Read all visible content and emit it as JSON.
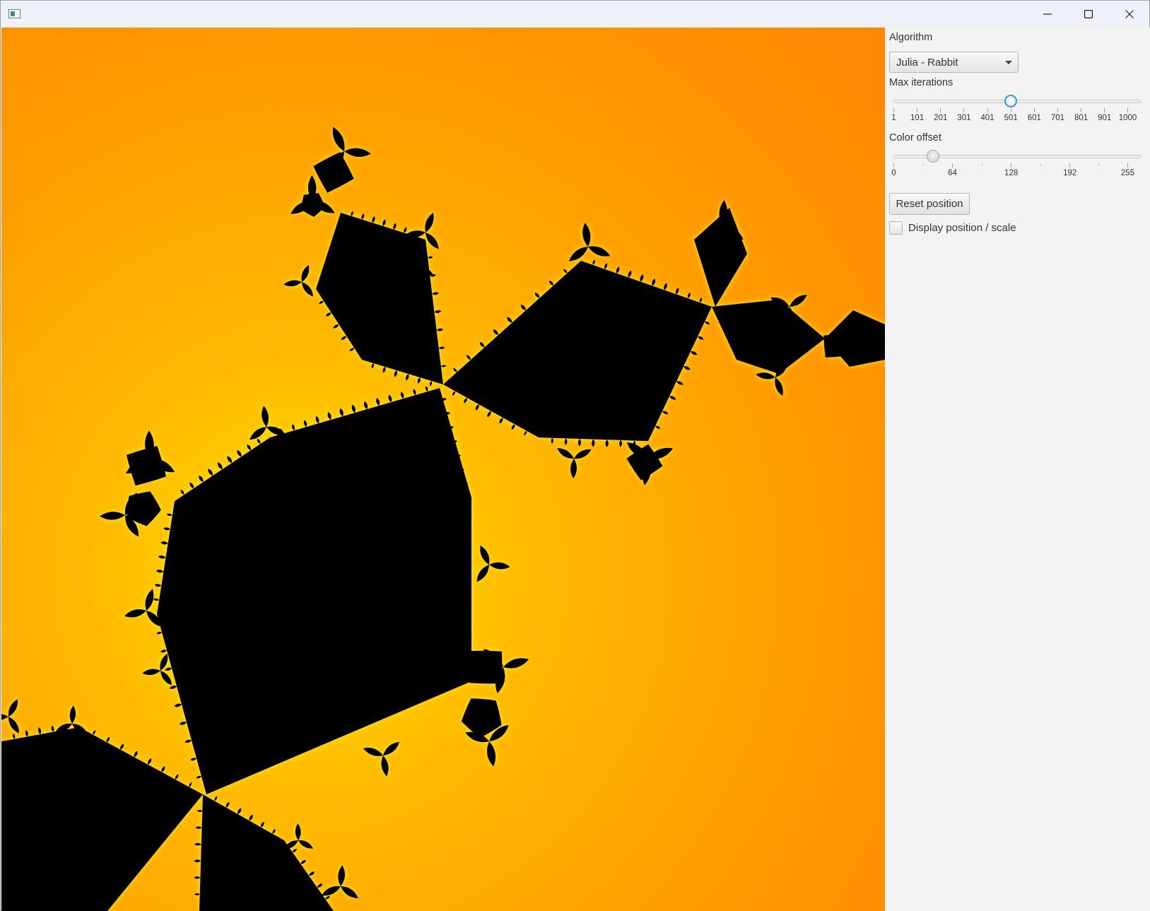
{
  "window": {
    "title": "",
    "controls": {
      "minimize": "minimize-icon",
      "maximize": "maximize-icon",
      "close": "close-icon"
    }
  },
  "canvas": {
    "fractal": "Julia - Rabbit",
    "colors": {
      "background_outer": "#ff8a00",
      "background_inner": "#ffc400",
      "edge_glow": "#ffee00",
      "set": "#000000"
    }
  },
  "panel": {
    "algorithm_label": "Algorithm",
    "algorithm_value": "Julia - Rabbit",
    "max_iterations_label": "Max iterations",
    "max_iterations": {
      "min": 1,
      "max": 1000,
      "value": 501,
      "tick_labels": [
        "1",
        "101",
        "201",
        "301",
        "401",
        "501",
        "601",
        "701",
        "801",
        "901",
        "1000"
      ]
    },
    "color_offset_label": "Color offset",
    "color_offset": {
      "min": 0,
      "max": 255,
      "value": 43,
      "tick_labels": [
        "0",
        "64",
        "128",
        "192",
        "255"
      ]
    },
    "reset_button": "Reset position",
    "display_checkbox_label": "Display position / scale",
    "display_checkbox_checked": false
  }
}
